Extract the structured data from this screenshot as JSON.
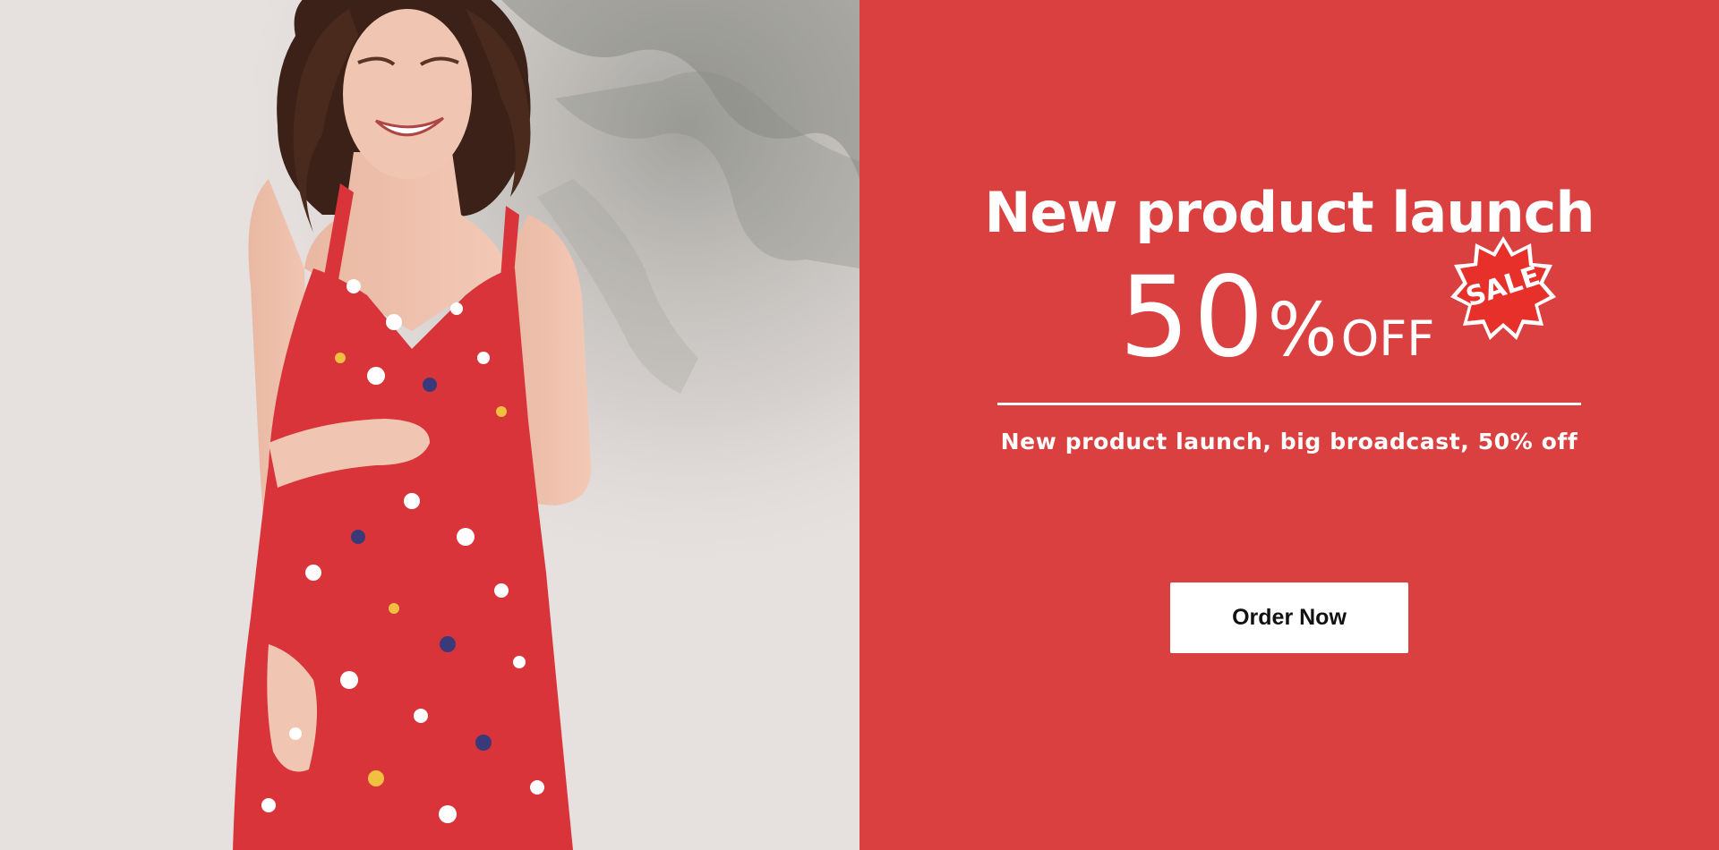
{
  "promo": {
    "headline": "New product launch",
    "discount_number": "50",
    "discount_percent": "%",
    "discount_off": "OFF",
    "badge_text": "SALE",
    "subline": "New product launch, big broadcast, 50% off",
    "cta_label": "Order Now"
  },
  "colors": {
    "panel_background": "#db4040",
    "badge_background": "#e8302b",
    "text": "#ffffff",
    "button_background": "#ffffff",
    "button_text": "#111111",
    "dress": "#d8343a"
  },
  "icons": {
    "badge": "sale-starburst-badge"
  }
}
